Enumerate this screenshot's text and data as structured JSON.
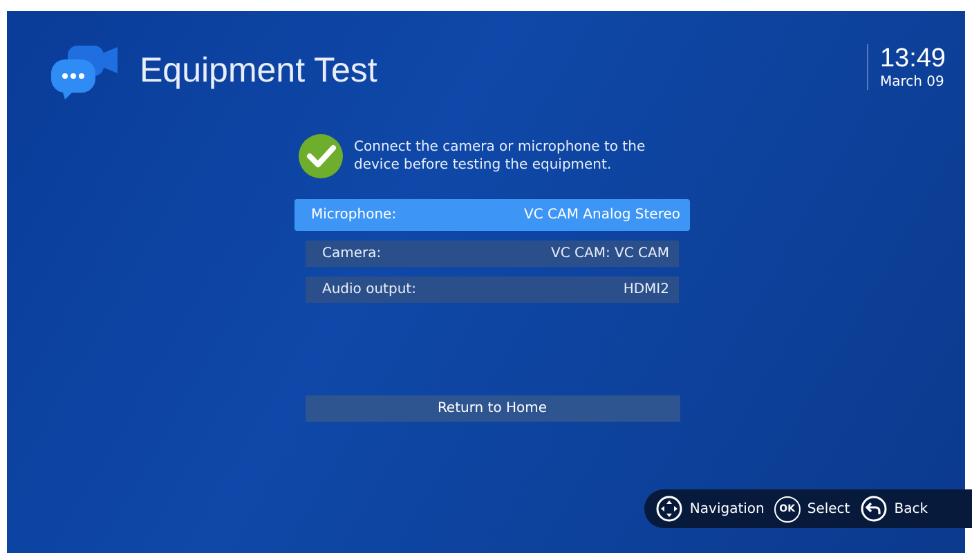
{
  "header": {
    "title": "Equipment Test",
    "time": "13:49",
    "date": "March 09"
  },
  "notice": {
    "text": "Connect the camera or microphone to the device before testing the equipment."
  },
  "settings": [
    {
      "label": "Microphone:",
      "value": "VC CAM Analog Stereo",
      "selected": true
    },
    {
      "label": "Camera:",
      "value": "VC CAM: VC CAM",
      "selected": false
    },
    {
      "label": "Audio output:",
      "value": "HDMI2",
      "selected": false
    }
  ],
  "return_button": {
    "label": "Return to Home",
    "selected": false
  },
  "hints": [
    {
      "kind": "dpad",
      "label": "Navigation"
    },
    {
      "kind": "ok",
      "icon_text": "OK",
      "label": "Select"
    },
    {
      "kind": "back",
      "label": "Back"
    }
  ]
}
